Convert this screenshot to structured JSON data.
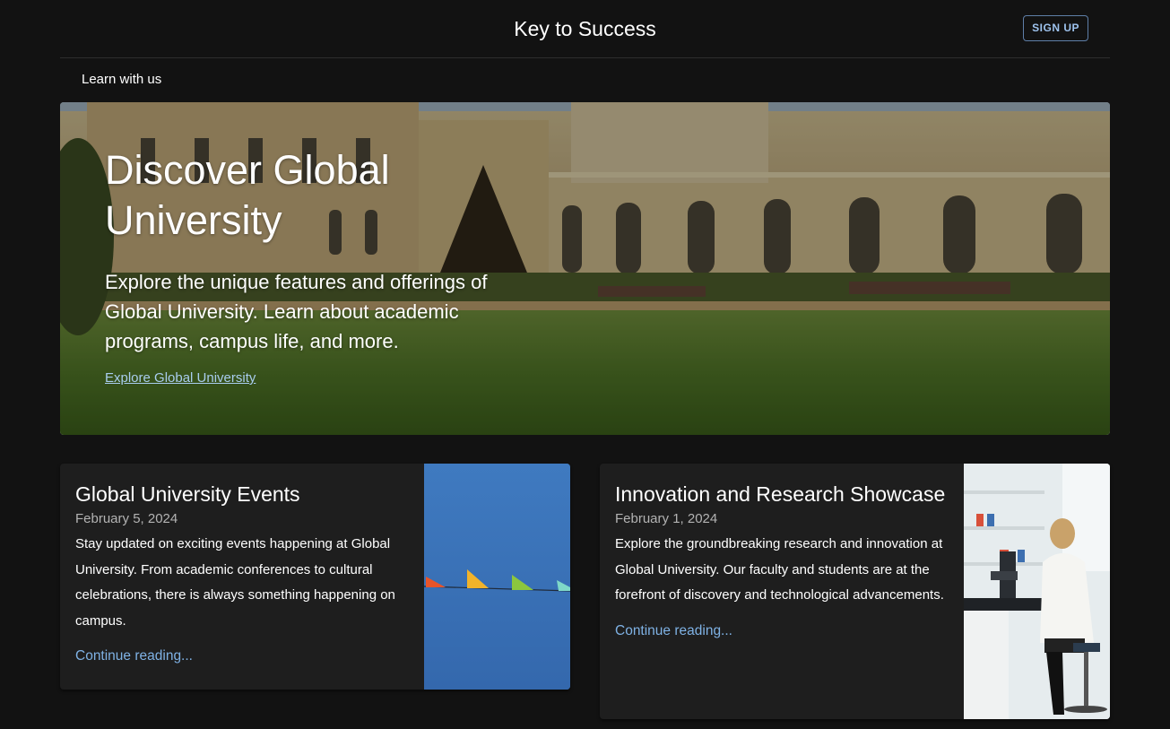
{
  "header": {
    "title": "Key to Success",
    "signup_label": "SIGN UP"
  },
  "nav": {
    "items": [
      {
        "label": "Learn with us"
      }
    ]
  },
  "hero": {
    "title": "Discover Global University",
    "description": "Explore the unique features and offerings of Global University. Learn about academic programs, campus life, and more.",
    "link_label": "Explore Global University",
    "image": "university-campus-photo"
  },
  "posts": [
    {
      "title": "Global University Events",
      "date": "February 5, 2024",
      "description": "Stay updated on exciting events happening at Global University. From academic conferences to cultural celebrations, there is always something happening on campus.",
      "link_label": "Continue reading...",
      "image": "colorful-bunting-flags-photo"
    },
    {
      "title": "Innovation and Research Showcase",
      "date": "February 1, 2024",
      "description": "Explore the groundbreaking research and innovation at Global University. Our faculty and students are at the forefront of discovery and technological advancements.",
      "link_label": "Continue reading...",
      "image": "scientist-microscope-lab-photo"
    }
  ],
  "colors": {
    "background": "#121212",
    "card": "#1e1e1e",
    "link": "#7fb2e5",
    "button_border": "#5f7fa8"
  }
}
